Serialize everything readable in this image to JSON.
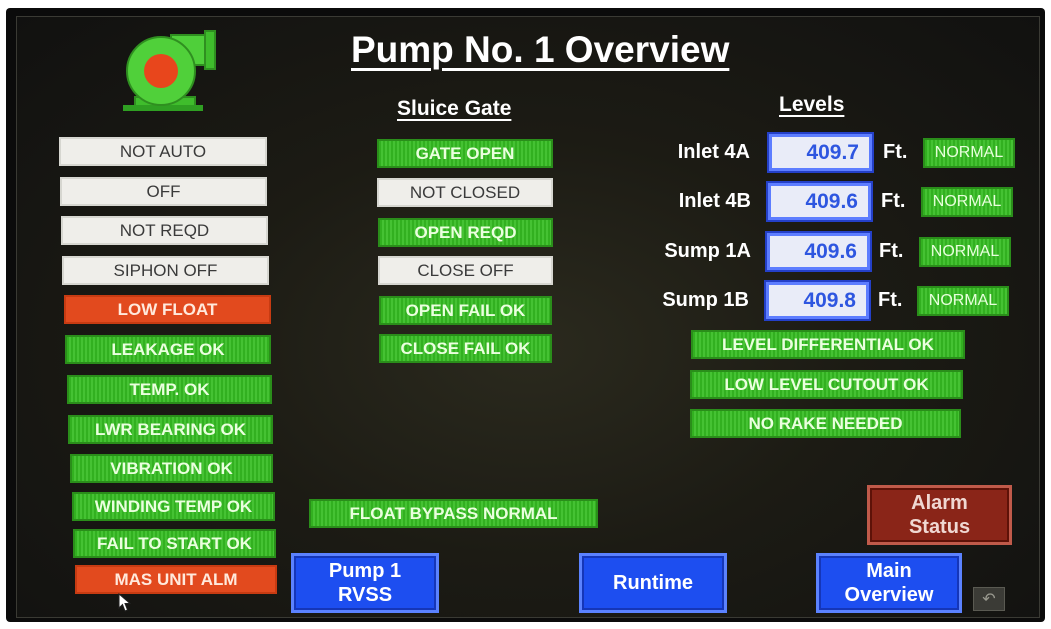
{
  "screen": {
    "title": "Pump No. 1 Overview"
  },
  "sluice_gate": {
    "header": "Sluice Gate",
    "items": [
      {
        "label": "GATE OPEN",
        "style": "green"
      },
      {
        "label": "NOT CLOSED",
        "style": "white"
      },
      {
        "label": "OPEN REQD",
        "style": "green"
      },
      {
        "label": "CLOSE OFF",
        "style": "white"
      },
      {
        "label": "OPEN FAIL OK",
        "style": "green"
      },
      {
        "label": "CLOSE FAIL OK",
        "style": "green"
      }
    ]
  },
  "pump_status": {
    "items": [
      {
        "label": "NOT AUTO",
        "style": "white"
      },
      {
        "label": "OFF",
        "style": "white"
      },
      {
        "label": "NOT REQD",
        "style": "white"
      },
      {
        "label": "SIPHON OFF",
        "style": "white"
      },
      {
        "label": "LOW FLOAT",
        "style": "red"
      },
      {
        "label": "LEAKAGE OK",
        "style": "green"
      },
      {
        "label": "TEMP. OK",
        "style": "green"
      },
      {
        "label": "LWR BEARING OK",
        "style": "green"
      },
      {
        "label": "VIBRATION OK",
        "style": "green"
      },
      {
        "label": "WINDING TEMP OK",
        "style": "green"
      },
      {
        "label": "FAIL TO START OK",
        "style": "green"
      },
      {
        "label": "MAS UNIT ALM",
        "style": "red"
      }
    ]
  },
  "levels": {
    "header": "Levels",
    "unit": "Ft.",
    "rows": [
      {
        "name": "Inlet 4A",
        "value": "409.7",
        "status": "NORMAL"
      },
      {
        "name": "Inlet 4B",
        "value": "409.6",
        "status": "NORMAL"
      },
      {
        "name": "Sump 1A",
        "value": "409.6",
        "status": "NORMAL"
      },
      {
        "name": "Sump 1B",
        "value": "409.8",
        "status": "NORMAL"
      }
    ],
    "indicators": [
      {
        "label": "LEVEL DIFFERENTIAL OK"
      },
      {
        "label": "LOW LEVEL CUTOUT OK"
      },
      {
        "label": "NO RAKE NEEDED"
      }
    ]
  },
  "float_bypass": {
    "label": "FLOAT BYPASS NORMAL"
  },
  "buttons": {
    "pump_rvss": {
      "line1": "Pump 1",
      "line2": "RVSS"
    },
    "runtime": {
      "label": "Runtime"
    },
    "main_overview": {
      "line1": "Main",
      "line2": "Overview"
    },
    "alarm_status": {
      "line1": "Alarm",
      "line2": "Status"
    }
  },
  "icons": {
    "pump": "pump-icon",
    "back": "back-arrow-icon",
    "cursor": "mouse-cursor-icon"
  },
  "colors": {
    "status_ok": "#3cb82a",
    "status_alarm": "#e24a1e",
    "status_inactive": "#efeeea",
    "nav_button": "#1d4ef0",
    "alarm_button": "#8a2518",
    "level_value": "#2e56e0"
  }
}
